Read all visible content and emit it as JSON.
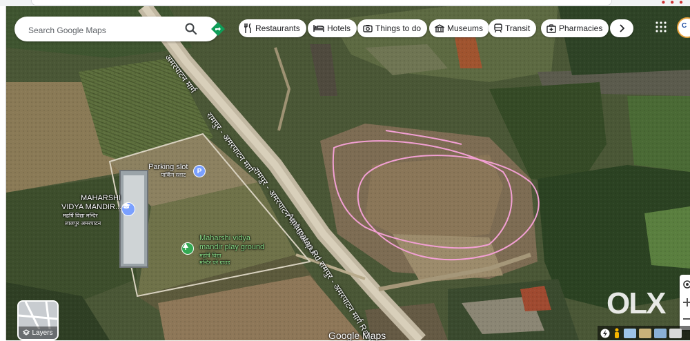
{
  "search": {
    "placeholder": "Search Google Maps"
  },
  "categories": [
    {
      "label": "Restaurants",
      "icon": "restaurant-icon"
    },
    {
      "label": "Hotels",
      "icon": "hotel-icon"
    },
    {
      "label": "Things to do",
      "icon": "camera-icon"
    },
    {
      "label": "Museums",
      "icon": "museum-icon"
    },
    {
      "label": "Transit",
      "icon": "train-icon"
    },
    {
      "label": "Pharmacies",
      "icon": "pharmacy-icon"
    }
  ],
  "map_labels": {
    "parking_name": "Parking slot",
    "parking_name_local": "पार्किंग स्लाट",
    "school_line1": "MAHARSHI",
    "school_line2": "VIDYA MANDIR...",
    "school_local_line1": "महर्षि विद्या मन्दिर",
    "school_local_line2": "लालपुर अमरपाटन",
    "playground_line1": "Maharshi vidya",
    "playground_line2": "mandir play ground",
    "playground_local_line1": "महर्षि विद्या",
    "playground_local_line2": "मन्दिर प्ले ग्राउंड",
    "road_upper": "रामपुर - अमरपाटन मार्ग",
    "road_middle": "रामपुर - अमरपाटन मार्ग Rampur",
    "road_lower": "- Amarpatan Rd रामपुर - अमरपाटन मार्ग Rampur",
    "road_top": "अमरपाटन मार्ग"
  },
  "layers_label": "Layers",
  "attribution": "Google Maps",
  "watermark": "OLX",
  "colors": {
    "accent": "#1a73e8",
    "annotation": "#f29bd0",
    "pin_blue": "#7aa0ff",
    "pin_green": "#34a853"
  },
  "avatar_text": "C"
}
